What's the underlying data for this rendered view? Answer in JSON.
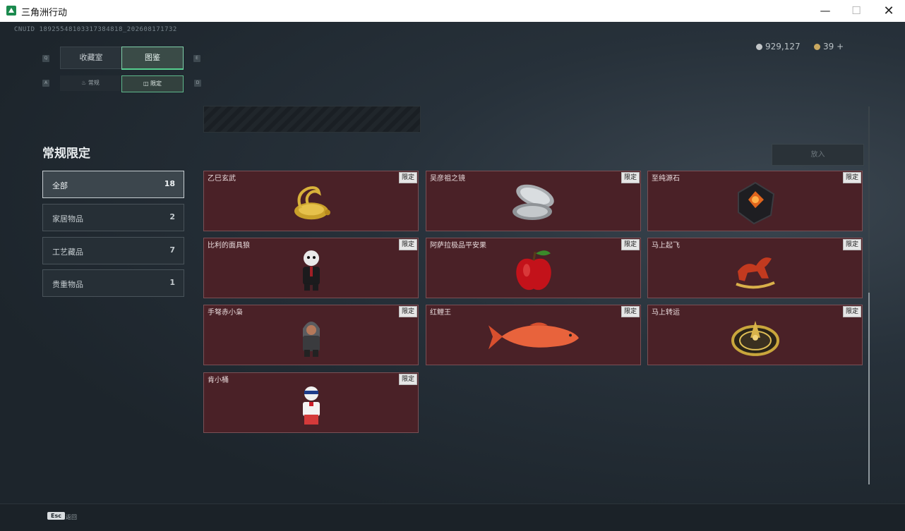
{
  "window": {
    "title": "三角洲行动",
    "minimize": "—",
    "maximize": "☐",
    "close": "✕"
  },
  "uid": "CNUID 18925548103317384818_202608171732",
  "currency": {
    "silver": "929,127",
    "gold": "39 +"
  },
  "tabs": [
    {
      "label": "收藏室",
      "key": "Q"
    },
    {
      "label": "图鉴",
      "key": "E"
    }
  ],
  "subtabs": [
    {
      "label": "常规",
      "key": "A",
      "icon": "♨"
    },
    {
      "label": "限定",
      "key": "D",
      "icon": "◫"
    }
  ],
  "section_title": "常规限定",
  "categories": [
    {
      "label": "全部",
      "count": "18"
    },
    {
      "label": "家居物品",
      "count": "2"
    },
    {
      "label": "工艺藏品",
      "count": "7"
    },
    {
      "label": "贵重物品",
      "count": "1"
    }
  ],
  "action_button": "放入",
  "badge_label": "限定",
  "items": [
    {
      "name": "乙巳玄武",
      "icon": "golden-turtle-snake"
    },
    {
      "name": "吴彦祖之镜",
      "icon": "silver-compact-mirror"
    },
    {
      "name": "至纯源石",
      "icon": "dark-crystal"
    },
    {
      "name": "比利的面具狼",
      "icon": "puppet-figure"
    },
    {
      "name": "阿萨拉极品平安果",
      "icon": "red-apple"
    },
    {
      "name": "马上起飞",
      "icon": "red-horse"
    },
    {
      "name": "手弩赤小枭",
      "icon": "hooded-figure"
    },
    {
      "name": "红鲤王",
      "icon": "red-carp"
    },
    {
      "name": "马上转运",
      "icon": "golden-compass"
    },
    {
      "name": "肯小桶",
      "icon": "colonel-figure"
    }
  ],
  "footer": {
    "key": "Esc",
    "label": "返回"
  },
  "colors": {
    "accent": "#55d08f",
    "card_bg": "#4a2127",
    "card_border": "#7a5055"
  }
}
